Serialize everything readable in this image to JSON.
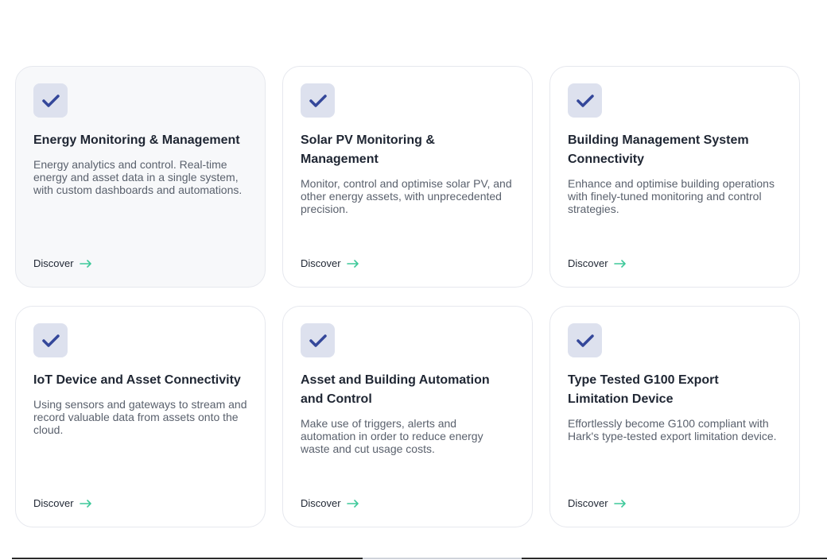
{
  "colors": {
    "accent_check": "#34479a",
    "badge_bg": "#dde1ee",
    "arrow": "#3ec99a"
  },
  "cards": [
    {
      "title": "Energy Monitoring & Management",
      "description": "Energy analytics and control. Real-time energy and asset data in a single system, with custom dashboards and automations.",
      "link_label": "Discover",
      "icon": "check-icon"
    },
    {
      "title": "Solar PV Monitoring & Management",
      "description": "Monitor, control and optimise solar PV, and other energy assets, with unprecedented precision.",
      "link_label": "Discover",
      "icon": "check-icon"
    },
    {
      "title": "Building Management System Connectivity",
      "description": "Enhance and optimise building operations with finely-tuned monitoring and control strategies.",
      "link_label": "Discover",
      "icon": "check-icon"
    },
    {
      "title": "IoT Device and Asset Connectivity",
      "description": "Using sensors and gateways to stream and record valuable data from assets onto the cloud.",
      "link_label": "Discover",
      "icon": "check-icon"
    },
    {
      "title": "Asset and Building Automation and Control",
      "description": "Make use of triggers, alerts and automation in order to reduce energy waste and cut usage costs.",
      "link_label": "Discover",
      "icon": "check-icon"
    },
    {
      "title": "Type Tested G100 Export Limitation Device",
      "description": "Effortlessly become G100 compliant with Hark's type-tested export limitation device.",
      "link_label": "Discover",
      "icon": "check-icon"
    }
  ]
}
